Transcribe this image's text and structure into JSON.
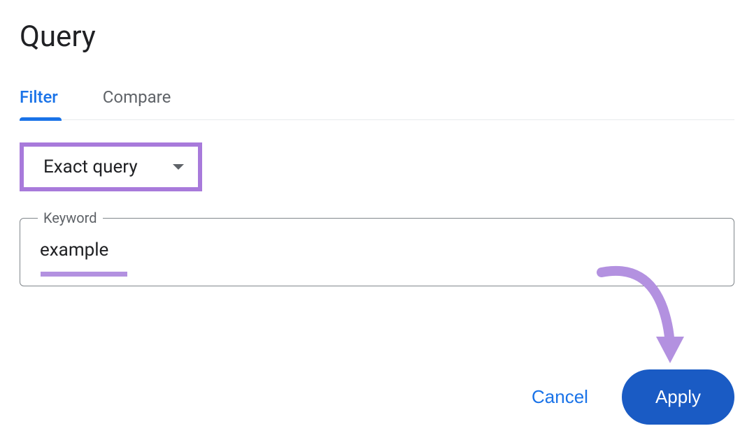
{
  "title": "Query",
  "tabs": {
    "filter": "Filter",
    "compare": "Compare"
  },
  "select": {
    "value": "Exact query"
  },
  "input": {
    "label": "Keyword",
    "value": "example"
  },
  "actions": {
    "cancel": "Cancel",
    "apply": "Apply"
  }
}
